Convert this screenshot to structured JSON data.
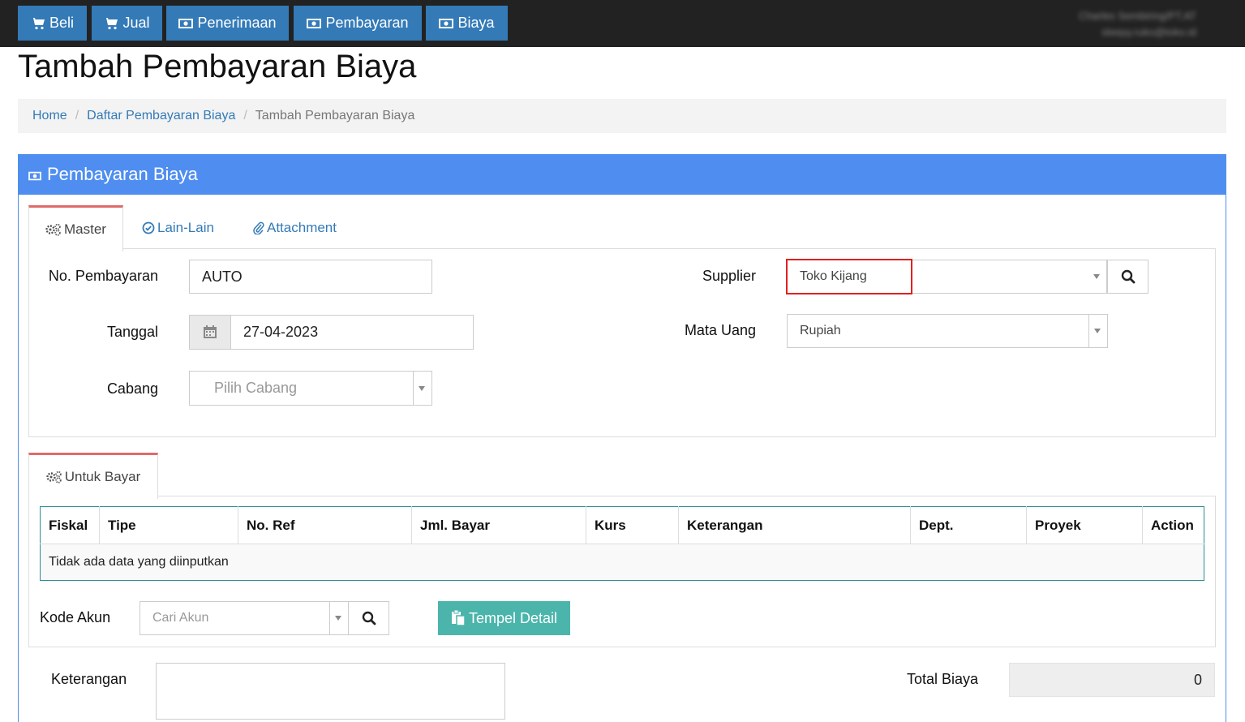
{
  "topnav": {
    "items": [
      {
        "label": "Beli",
        "icon": "cart-icon"
      },
      {
        "label": "Jual",
        "icon": "cart-icon"
      },
      {
        "label": "Penerimaan",
        "icon": "money-icon"
      },
      {
        "label": "Pembayaran",
        "icon": "money-icon"
      },
      {
        "label": "Biaya",
        "icon": "money-icon"
      }
    ],
    "user_name": "Charles Sembiring/PT.AT",
    "user_email": "sleepy.ruko@toko.id"
  },
  "page": {
    "title": "Tambah Pembayaran Biaya"
  },
  "breadcrumb": {
    "home": "Home",
    "list": "Daftar Pembayaran Biaya",
    "current": "Tambah Pembayaran Biaya"
  },
  "panel": {
    "title": "Pembayaran Biaya"
  },
  "tabs": {
    "master": "Master",
    "lain": "Lain-Lain",
    "attachment": "Attachment"
  },
  "master": {
    "no_pembayaran_label": "No. Pembayaran",
    "no_pembayaran_value": "AUTO",
    "tanggal_label": "Tanggal",
    "tanggal_value": "27-04-2023",
    "cabang_label": "Cabang",
    "cabang_placeholder": "Pilih Cabang",
    "supplier_label": "Supplier",
    "supplier_value": "Toko Kijang",
    "mata_uang_label": "Mata Uang",
    "mata_uang_value": "Rupiah"
  },
  "untuk_bayar": {
    "tab_label": "Untuk Bayar",
    "columns": [
      "Fiskal",
      "Tipe",
      "No. Ref",
      "Jml. Bayar",
      "Kurs",
      "Keterangan",
      "Dept.",
      "Proyek",
      "Action"
    ],
    "empty_text": "Tidak ada data yang diinputkan",
    "kode_akun_label": "Kode Akun",
    "cari_akun_placeholder": "Cari Akun",
    "tempel_label": "Tempel Detail"
  },
  "footer": {
    "keterangan_label": "Keterangan",
    "total_label": "Total Biaya",
    "total_value": "0"
  }
}
